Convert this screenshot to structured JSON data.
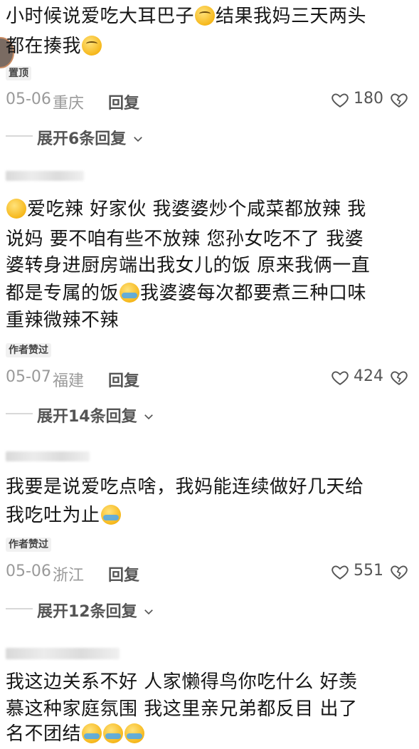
{
  "comments": [
    {
      "lines": [
        "小时候说爱吃大耳巴子",
        "结果我妈三天两头",
        "都在揍我"
      ],
      "badge": "置顶",
      "date": "05-06",
      "region": "重庆",
      "reply_label": "回复",
      "likes": "180",
      "expand_label": "展开6条回复"
    },
    {
      "lines": [
        "爱吃辣 好家伙 我婆婆炒个咸菜都放辣 我",
        "说妈 要不咱有些不放辣 您孙女吃不了 我婆",
        "婆转身进厨房端出我女儿的饭 原来我俩一直",
        "都是专属的饭",
        "我婆婆每次都要煮三种口味",
        "重辣微辣不辣"
      ],
      "badge": "作者赞过",
      "date": "05-07",
      "region": "福建",
      "reply_label": "回复",
      "likes": "424",
      "expand_label": "展开14条回复"
    },
    {
      "lines": [
        "我要是说爱吃点啥，我妈能连续做好几天给",
        "我吃吐为止"
      ],
      "badge": "作者赞过",
      "date": "05-06",
      "region": "浙江",
      "reply_label": "回复",
      "likes": "551",
      "expand_label": "展开12条回复"
    },
    {
      "lines": [
        "我这边关系不好  人家懒得鸟你吃什么   好羡",
        "慕这种家庭氛围   我这里亲兄弟都反目   出了",
        "名不团结"
      ]
    }
  ],
  "icons": {
    "heart": "heart-icon",
    "dislike": "broken-heart-icon",
    "chevron": "chevron-down-icon"
  }
}
